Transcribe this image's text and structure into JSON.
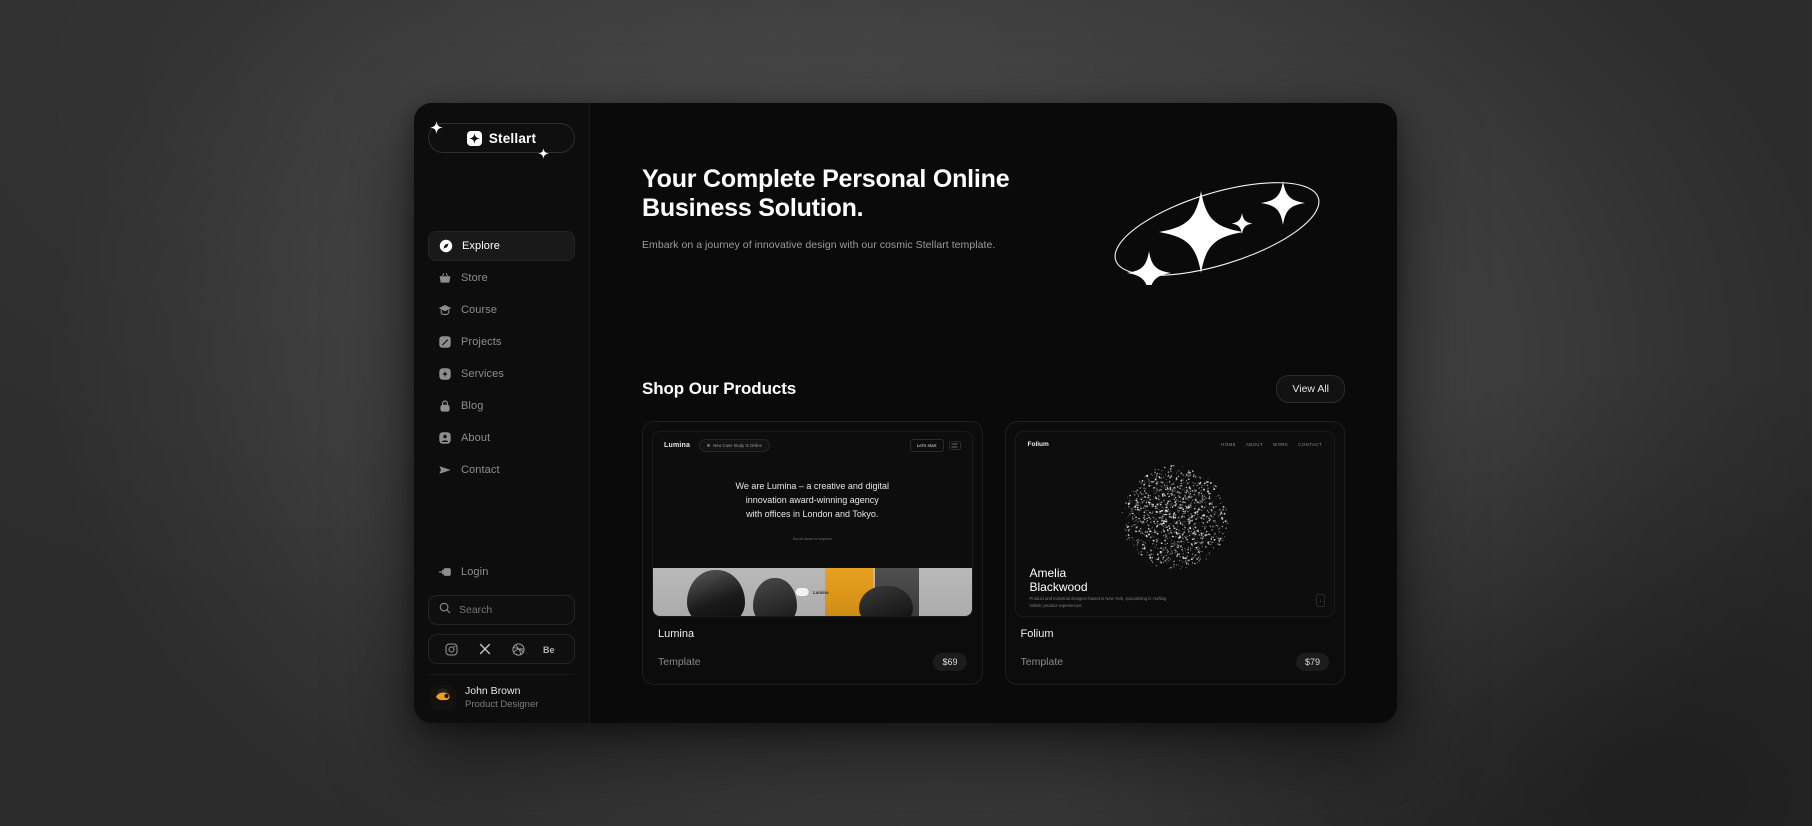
{
  "brand": {
    "name": "Stellart",
    "logo_icon": "sparkle-mark-icon"
  },
  "sidebar": {
    "nav": [
      {
        "label": "Explore",
        "icon": "compass-icon",
        "active": true
      },
      {
        "label": "Store",
        "icon": "basket-icon",
        "active": false
      },
      {
        "label": "Course",
        "icon": "graduation-cap-icon",
        "active": false
      },
      {
        "label": "Projects",
        "icon": "edit-square-icon",
        "active": false
      },
      {
        "label": "Services",
        "icon": "plus-badge-icon",
        "active": false
      },
      {
        "label": "Blog",
        "icon": "lock-icon",
        "active": false
      },
      {
        "label": "About",
        "icon": "user-circle-icon",
        "active": false
      },
      {
        "label": "Contact",
        "icon": "send-icon",
        "active": false
      }
    ],
    "login": {
      "label": "Login",
      "icon": "login-arrow-icon"
    },
    "search": {
      "placeholder": "Search",
      "icon": "search-icon",
      "value": ""
    },
    "social": [
      {
        "name": "instagram-icon",
        "label": "Instagram"
      },
      {
        "name": "x-icon",
        "label": "X"
      },
      {
        "name": "dribbble-icon",
        "label": "Dribbble"
      },
      {
        "name": "behance-icon",
        "label": "Be"
      }
    ],
    "profile": {
      "name": "John Brown",
      "role": "Product Designer"
    }
  },
  "hero": {
    "title_line1": "Your Complete Personal Online",
    "title_line2": "Business Solution.",
    "subtitle": "Embark on a journey of innovative design with our cosmic Stellart template.",
    "art_icon": "orbit-sparkles-graphic"
  },
  "shop": {
    "title": "Shop Our Products",
    "view_all_label": "View All",
    "products": [
      {
        "name": "Lumina",
        "type": "Template",
        "price": "$69",
        "preview": {
          "brand": "Lumina",
          "badge": "New Case Study Is Online",
          "cta": "Let's start",
          "headline_l1": "We are Lumina – a creative and digital",
          "headline_l2": "innovation award-winning agency",
          "headline_l3": "with offices in London and Tokyo.",
          "scroll_hint": "Scroll down to explore",
          "pill_label": "Lumina"
        }
      },
      {
        "name": "Folium",
        "type": "Template",
        "price": "$79",
        "preview": {
          "brand": "Folium",
          "nav": [
            "HOME",
            "ABOUT",
            "WORK",
            "CONTACT"
          ],
          "title_l1": "Amelia",
          "title_l2": "Blackwood",
          "desc": "Product and industrial designer based in New York, specializing in crafting holistic product experiences."
        }
      }
    ]
  },
  "colors": {
    "app_bg": "#0a0a0a",
    "sidebar_bg": "#0d0d0d",
    "accent": "#ffffff",
    "muted_text": "#8d8d8d",
    "orange": "#e8a020"
  }
}
